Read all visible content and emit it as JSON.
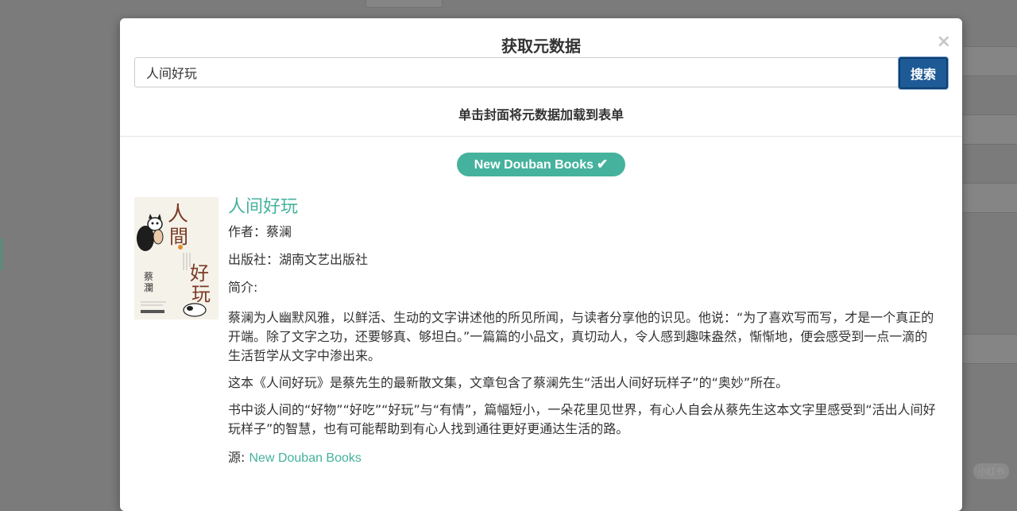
{
  "modal": {
    "title": "获取元数据",
    "close": "×",
    "search": {
      "value": "人间好玩",
      "placeholder": "",
      "button": "搜索"
    },
    "hint": "单击封面将元数据加载到表单"
  },
  "source_badge": {
    "label": "New Douban Books",
    "icon": "check-icon"
  },
  "result": {
    "title": "人间好玩",
    "author_label": "作者：",
    "author": "蔡澜",
    "publisher_label": "出版社：",
    "publisher": "湖南文艺出版社",
    "desc_label": "简介:",
    "paragraphs": [
      "蔡澜为人幽默风雅，以鲜活、生动的文字讲述他的所见所闻，与读者分享他的识见。他说：“为了喜欢写而写，才是一个真正的开端。除了文字之功，还要够真、够坦白。”一篇篇的小品文，真切动人，令人感到趣味盎然，惭惭地，便会感受到一点一滴的生活哲学从文字中渗出来。",
      "这本《人间好玩》是蔡先生的最新散文集，文章包含了蔡澜先生“活出人间好玩样子”的“奥妙”所在。",
      "书中谈人间的“好物”“好吃”“好玩”与“有情”，篇幅短小，一朵花里见世界，有心人自会从蔡先生这本文字里感受到“活出人间好玩样子”的智慧，也有可能帮助到有心人找到通往更好更通达生活的路。"
    ],
    "source_label": "源: ",
    "source_link": "New Douban Books"
  },
  "colors": {
    "accent": "#45b29d",
    "primary_button": "#1d5a96"
  }
}
